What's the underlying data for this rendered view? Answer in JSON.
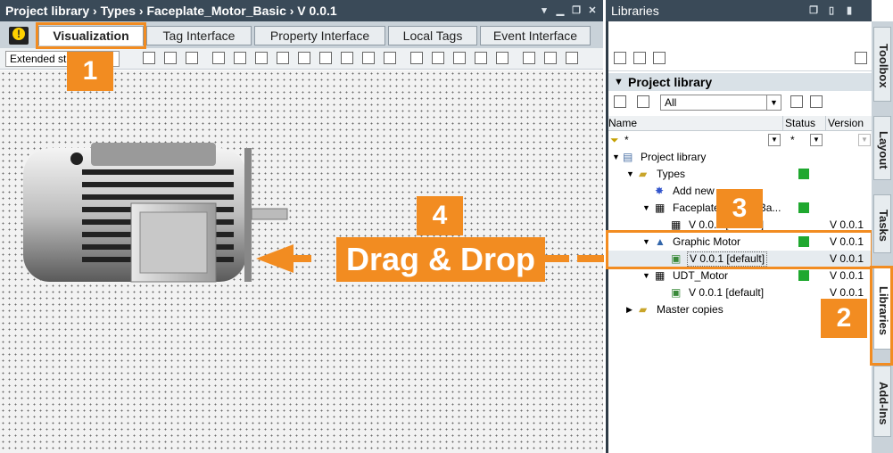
{
  "editor": {
    "title": "Project library  ›  Types  ›  Faceplate_Motor_Basic  ›  V 0.0.1",
    "tabs": [
      "Visualization",
      "Tag Interface",
      "Property Interface",
      "Local Tags",
      "Event Interface"
    ],
    "style_combo": "Extended st",
    "warning_icon": "!"
  },
  "libraries": {
    "title": "Libraries",
    "section": "Project library",
    "filter": "All",
    "columns": {
      "name": "Name",
      "status": "Status",
      "version": "Version"
    },
    "filter_row": {
      "name": "*",
      "status": "*"
    },
    "tree": [
      {
        "label": "Project library",
        "version": "",
        "status": false
      },
      {
        "label": "Types",
        "version": "",
        "status": true
      },
      {
        "label": "Add new",
        "version": "",
        "status": false
      },
      {
        "label": "Faceplate_Motor_Ba...",
        "version": "",
        "status": true
      },
      {
        "label": "V 0.0.1 [default]",
        "version": "V 0.0.1",
        "status": false
      },
      {
        "label": "Graphic Motor",
        "version": "V 0.0.1",
        "status": true
      },
      {
        "label": "V 0.0.1 [default]",
        "version": "V 0.0.1",
        "status": false
      },
      {
        "label": "UDT_Motor",
        "version": "V 0.0.1",
        "status": true
      },
      {
        "label": "V 0.0.1 [default]",
        "version": "V 0.0.1",
        "status": false
      },
      {
        "label": "Master copies",
        "version": "",
        "status": false
      }
    ]
  },
  "side_tabs": [
    "Toolbox",
    "Layout",
    "Tasks",
    "Libraries",
    "Add-Ins"
  ],
  "callouts": [
    "1",
    "2",
    "3",
    "4"
  ],
  "drag_label": "Drag & Drop",
  "colors": {
    "accent": "#f28c21",
    "status_ok": "#1fa82f",
    "titlebar": "#3a4a58"
  }
}
